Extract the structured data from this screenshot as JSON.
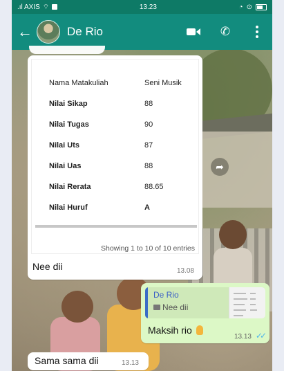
{
  "status_bar": {
    "carrier": ".ıl AXIS",
    "time": "13.23",
    "icons": [
      "wifi-icon",
      "alarm-icon",
      "sync-icon",
      "battery-icon"
    ]
  },
  "header": {
    "contact_name": "De Rio",
    "icons": [
      "back-arrow-icon",
      "video-call-icon",
      "phone-icon",
      "menu-icon"
    ]
  },
  "messages": {
    "image_message": {
      "table": {
        "rows": [
          {
            "key": "Nama Matakuliah",
            "value": "Seni Musik"
          },
          {
            "key": "Nilai Sikap",
            "value": "88"
          },
          {
            "key": "Nilai Tugas",
            "value": "90"
          },
          {
            "key": "Nilai Uts",
            "value": "87"
          },
          {
            "key": "Nilai Uas",
            "value": "88"
          },
          {
            "key": "Nilai Rerata",
            "value": "88.65"
          },
          {
            "key": "Nilai Huruf",
            "value": "A"
          }
        ],
        "footer": "Showing 1 to 10 of 10 entries"
      },
      "caption": "Nee dii",
      "time": "13.08"
    },
    "outgoing": {
      "reply_to_name": "De Rio",
      "reply_to_text": "Nee dii",
      "text": "Maksih rio",
      "time": "13.13",
      "status": "read"
    },
    "incoming": {
      "text": "Sama sama dii",
      "time": "13.13"
    }
  },
  "colors": {
    "header": "#128c7e",
    "status_bar": "#0e7a66",
    "outgoing_bubble": "#dcf8c6",
    "read_ticks": "#4fb6ec"
  }
}
